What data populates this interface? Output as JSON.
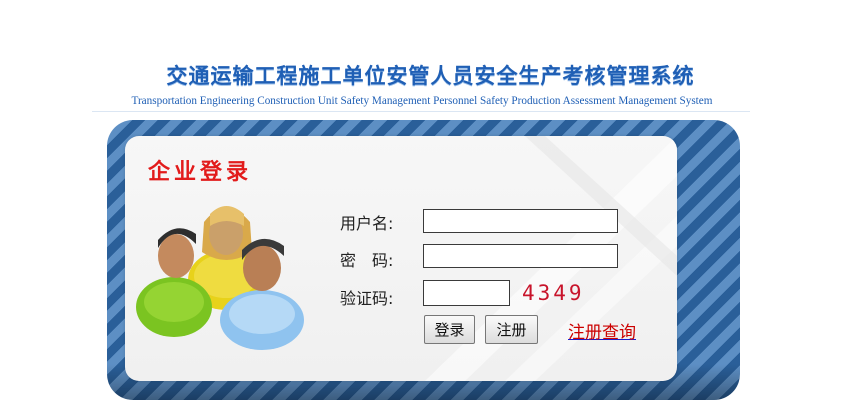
{
  "header": {
    "title_cn": "交通运输工程施工单位安管人员安全生产考核管理系统",
    "title_en": "Transportation Engineering Construction Unit Safety Management Personnel Safety Production Assessment Management System"
  },
  "login": {
    "title": "企业登录",
    "username_label": "用户名:",
    "username_value": "",
    "password_label": "密　码:",
    "password_value": "",
    "captcha_label": "验证码:",
    "captcha_value": "",
    "captcha_code": "4349",
    "login_button": "登录",
    "register_button": "注册",
    "registration_query_link": "注册查询"
  },
  "colors": {
    "title_blue": "#1f5fb5",
    "login_title_red": "#e21b1b",
    "captcha_red": "#c8142b",
    "frame_dark": "#2a5f99",
    "frame_light": "#5d8fc4"
  },
  "icons": {
    "illustration": "people-group-icon"
  }
}
